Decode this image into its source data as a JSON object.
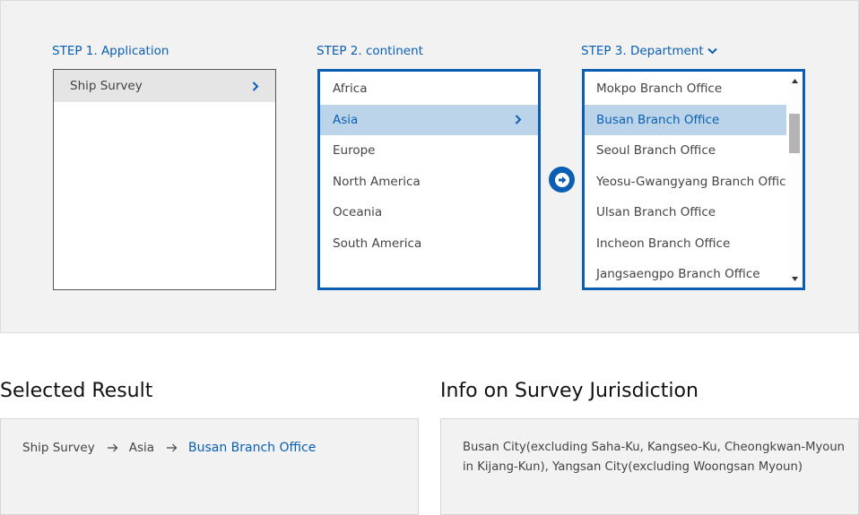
{
  "steps": {
    "step1": {
      "title": "STEP 1. Application",
      "items": [
        "Ship Survey"
      ]
    },
    "step2": {
      "title": "STEP 2. continent",
      "items": [
        "Africa",
        "Asia",
        "Europe",
        "North America",
        "Oceania",
        "South America"
      ]
    },
    "step3": {
      "title": "STEP 3. Department",
      "items": [
        "Mokpo Branch Office",
        "Busan Branch Office",
        "Seoul Branch Office",
        "Yeosu-Gwangyang Branch Office",
        "Ulsan Branch Office",
        "Incheon Branch Office",
        "Jangsaengpo Branch Office"
      ]
    }
  },
  "selection": {
    "application": "Ship Survey",
    "continent": "Asia",
    "department": "Busan Branch Office"
  },
  "result": {
    "title": "Selected Result",
    "path": [
      "Ship Survey",
      "Asia",
      "Busan Branch Office"
    ]
  },
  "info": {
    "title": "Info on Survey Jurisdiction",
    "text": "Busan City(excluding Saha-Ku, Kangseo-Ku, Cheongkwan-Myoun in Kijang-Kun), Yangsan City(excluding Woongsan Myoun)"
  },
  "icons": {
    "item_arrow": "chevron-right-icon",
    "dropdown": "chevron-down-icon",
    "go": "circle-arrow-right-icon",
    "breadcrumb_sep": "arrow-right-icon",
    "scroll_up": "triangle-up-icon",
    "scroll_down": "triangle-down-icon"
  },
  "colors": {
    "accent": "#0a5fb4",
    "selected_bg": "#bcd4ea",
    "panel_bg": "#f2f2f2"
  }
}
